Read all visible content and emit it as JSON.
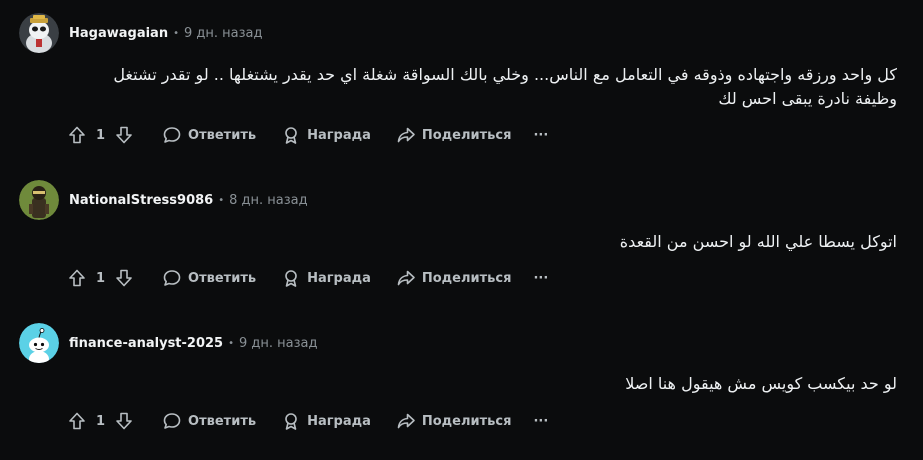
{
  "comments": [
    {
      "author": "Hagawagaian",
      "time": "9 дн. назад",
      "text": "كل واحد ورزقه واجتهاده وذوقه في التعامل مع الناس... وخلي بالك السواقة شغلة اي حد يقدر يشتغلها .. لو تقدر تشتغل وظيفة نادرة يبقى احس لك",
      "votes": "1",
      "avatar": "panda-avatar"
    },
    {
      "author": "NationalStress9086",
      "time": "8 дн. назад",
      "text": "اتوكل يسطا علي الله لو احسن من القعدة",
      "votes": "1",
      "avatar": "character-avatar"
    },
    {
      "author": "finance-analyst-2025",
      "time": "9 дн. назад",
      "text": "لو حد بيكسب كويس مش هيقول هنا اصلا",
      "votes": "1",
      "avatar": "snoo-avatar"
    }
  ],
  "labels": {
    "separator": "•",
    "reply": "Ответить",
    "award": "Награда",
    "share": "Поделиться",
    "more": "···"
  },
  "colors": {
    "background": "#0b0c0d",
    "text": "#eef1f3",
    "muted": "#8a9196",
    "snoo": "#5bd1e6"
  }
}
